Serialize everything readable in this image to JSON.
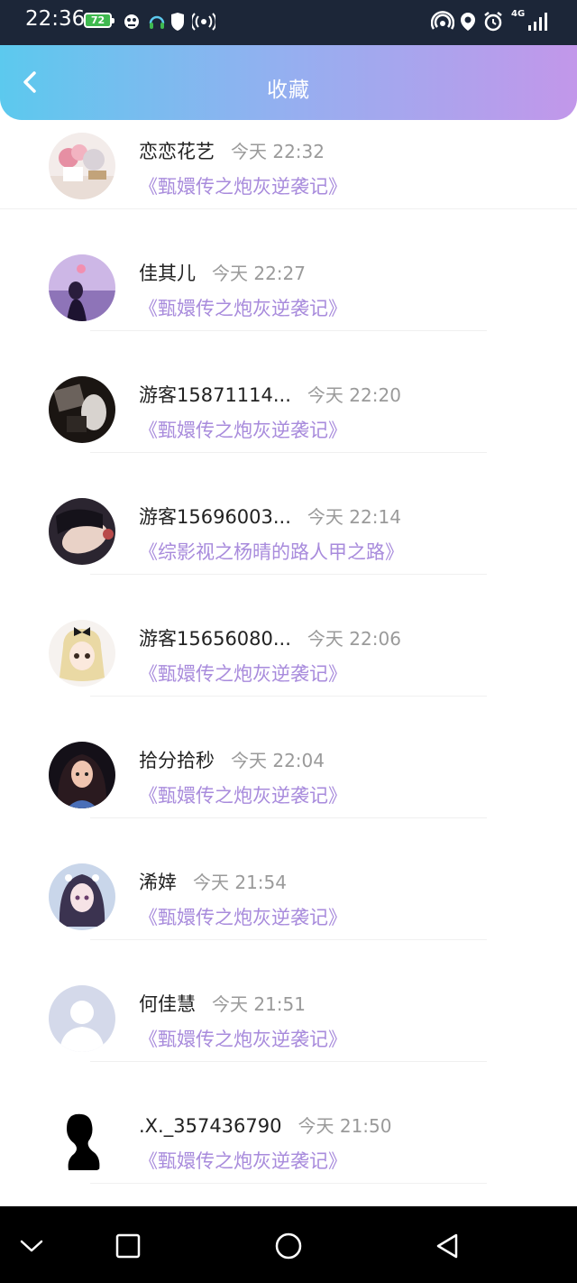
{
  "status_bar": {
    "time": "22:36",
    "battery": "72",
    "network": "4G",
    "icons": [
      "game-icon",
      "bluetooth-headset-icon",
      "shield-icon",
      "radio-icon",
      "hotspot-icon",
      "location-icon",
      "alarm-icon",
      "signal-icon"
    ]
  },
  "header": {
    "title": "收藏",
    "back_icon": "chevron-left-icon"
  },
  "favorites": [
    {
      "username": "恋恋花艺",
      "time": "今天 22:32",
      "book": "《甄嬛传之炮灰逆袭记》",
      "avatar": "flower-photo"
    },
    {
      "username": "佳其儿",
      "time": "今天 22:27",
      "book": "《甄嬛传之炮灰逆袭记》",
      "avatar": "girl-balloon-photo"
    },
    {
      "username": "游客15871114...",
      "time": "今天 22:20",
      "book": "《甄嬛传之炮灰逆袭记》",
      "avatar": "dark-portrait-photo"
    },
    {
      "username": "游客15696003...",
      "time": "今天 22:14",
      "book": "《综影视之杨晴的路人甲之路》",
      "avatar": "anime-boy-photo"
    },
    {
      "username": "游客15656080...",
      "time": "今天 22:06",
      "book": "《甄嬛传之炮灰逆袭记》",
      "avatar": "cartoon-girl-bow"
    },
    {
      "username": "拾分拾秒",
      "time": "今天 22:04",
      "book": "《甄嬛传之炮灰逆袭记》",
      "avatar": "painted-girl-photo"
    },
    {
      "username": "浠婞",
      "time": "今天 21:54",
      "book": "《甄嬛传之炮灰逆袭记》",
      "avatar": "doll-girl-photo"
    },
    {
      "username": "何佳慧",
      "time": "今天 21:51",
      "book": "《甄嬛传之炮灰逆袭记》",
      "avatar": "default-avatar"
    },
    {
      "username": ".X._357436790",
      "time": "今天 21:50",
      "book": "《甄嬛传之炮灰逆袭记》",
      "avatar": "silhouette-avatar"
    }
  ],
  "nav_bar": {
    "buttons": [
      "chevron-down-icon",
      "recents-square-icon",
      "home-circle-icon",
      "back-triangle-icon"
    ]
  },
  "colors": {
    "header_gradient_start": "#5cc9ee",
    "header_gradient_end": "#c297ea",
    "book_link": "#a88bdc",
    "timestamp": "#9a9a9a"
  }
}
